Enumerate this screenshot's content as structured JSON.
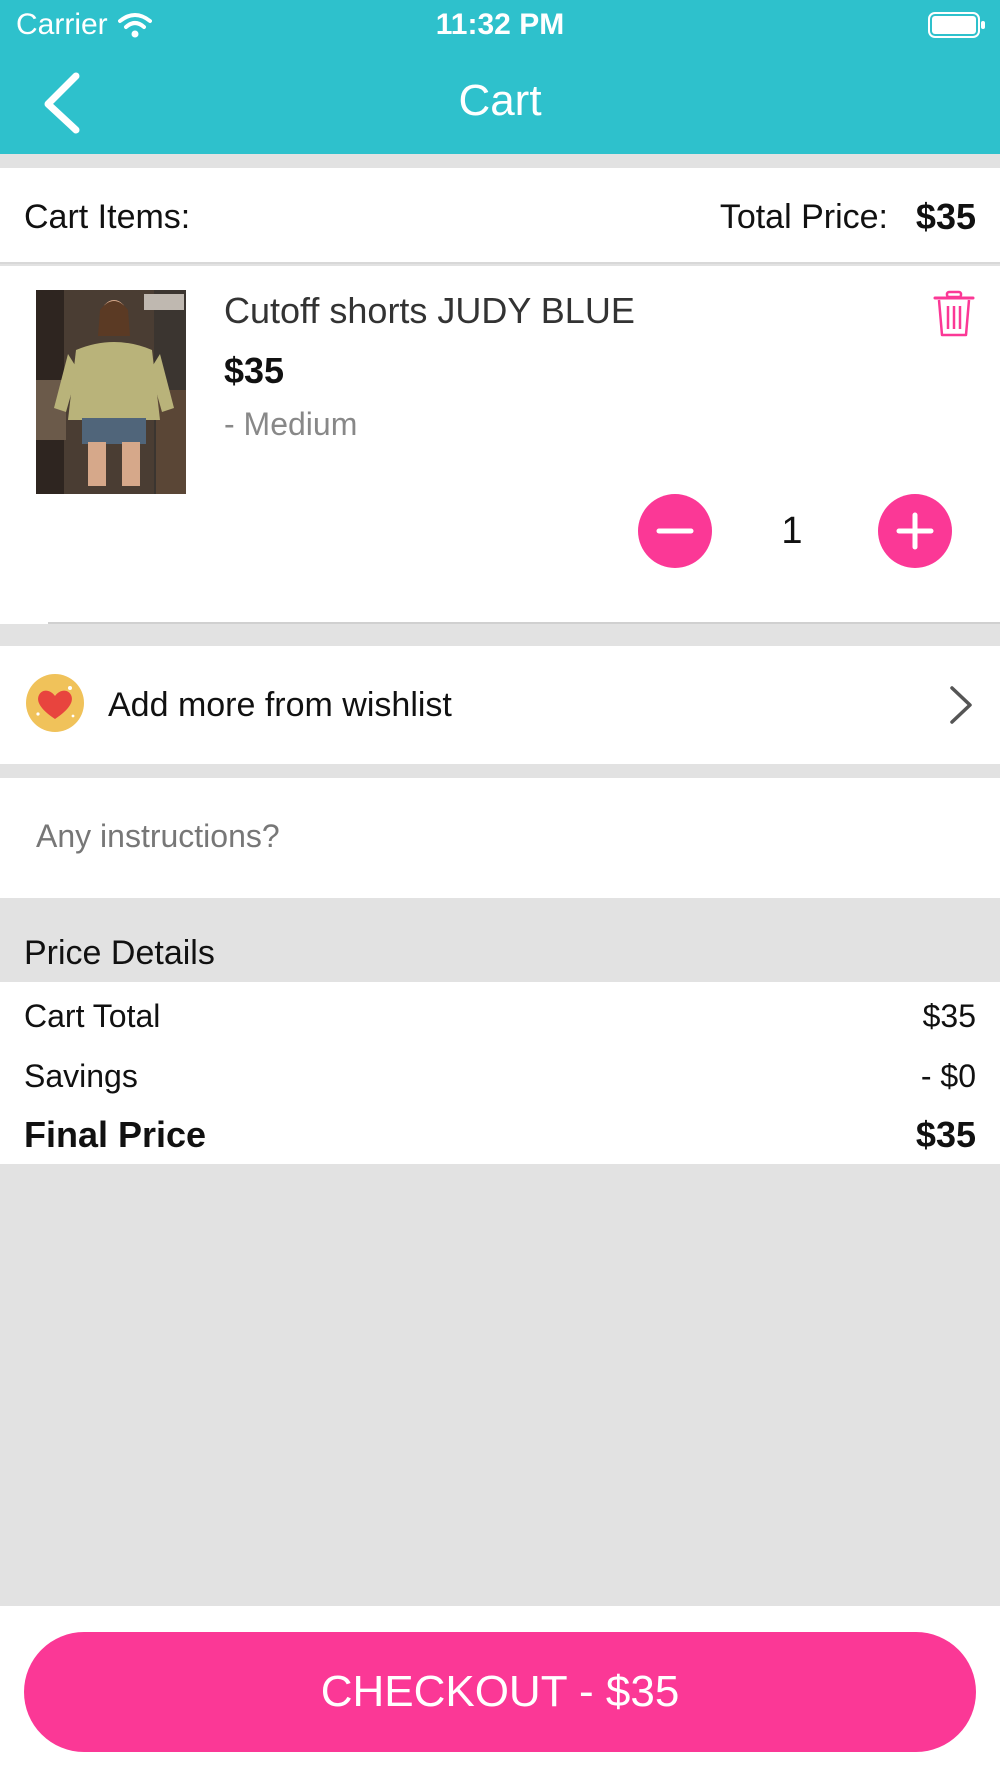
{
  "status_bar": {
    "carrier": "Carrier",
    "time": "11:32 PM"
  },
  "nav": {
    "title": "Cart",
    "back_icon": "chevron-left-icon"
  },
  "cart_header": {
    "items_label": "Cart Items:",
    "total_label": "Total Price:",
    "total_value": "$35"
  },
  "cart_item": {
    "name": "Cutoff shorts JUDY BLUE",
    "price": "$35",
    "variant": "- Medium",
    "quantity": "1",
    "delete_icon": "trash-icon"
  },
  "wishlist": {
    "label": "Add more from wishlist",
    "icon": "heart-icon"
  },
  "instructions": {
    "placeholder": "Any instructions?"
  },
  "price_details": {
    "title": "Price Details",
    "rows": [
      {
        "label": "Cart Total",
        "value": "$35"
      },
      {
        "label": "Savings",
        "value": "- $0"
      },
      {
        "label": "Final Price",
        "value": "$35"
      }
    ]
  },
  "checkout": {
    "label": "CHECKOUT - $35"
  },
  "colors": {
    "header": "#2ec1cc",
    "accent": "#fb3896",
    "background": "#e2e2e2"
  }
}
